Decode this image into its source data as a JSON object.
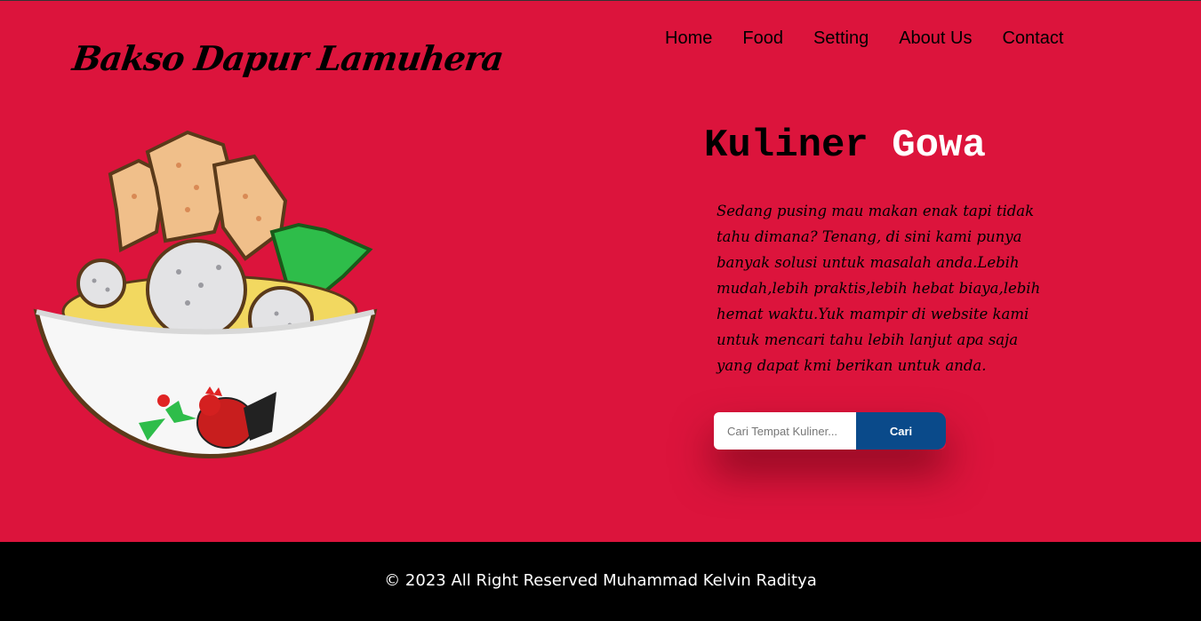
{
  "header": {
    "logo": "Bakso Dapur Lamuhera",
    "nav": [
      "Home",
      "Food",
      "Setting",
      "About Us",
      "Contact"
    ]
  },
  "hero": {
    "headline_part1": "Kuliner",
    "headline_part2": "Gowa",
    "description": "Sedang pusing mau makan enak tapi tidak tahu dimana? Tenang, di sini kami punya banyak solusi untuk masalah anda.Lebih mudah,lebih praktis,lebih hebat biaya,lebih hemat waktu.Yuk mampir di website kami untuk mencari tahu lebih lanjut apa saja yang dapat kmi berikan untuk anda.",
    "image_icon": "bakso-bowl-illustration"
  },
  "search": {
    "placeholder": "Cari Tempat Kuliner...",
    "button_label": "Cari"
  },
  "footer": {
    "copyright": "© 2023 All Right Reserved Muhammad Kelvin Raditya"
  },
  "colors": {
    "background": "#dc143c",
    "button": "#0a4a8a",
    "footer": "#000000"
  }
}
